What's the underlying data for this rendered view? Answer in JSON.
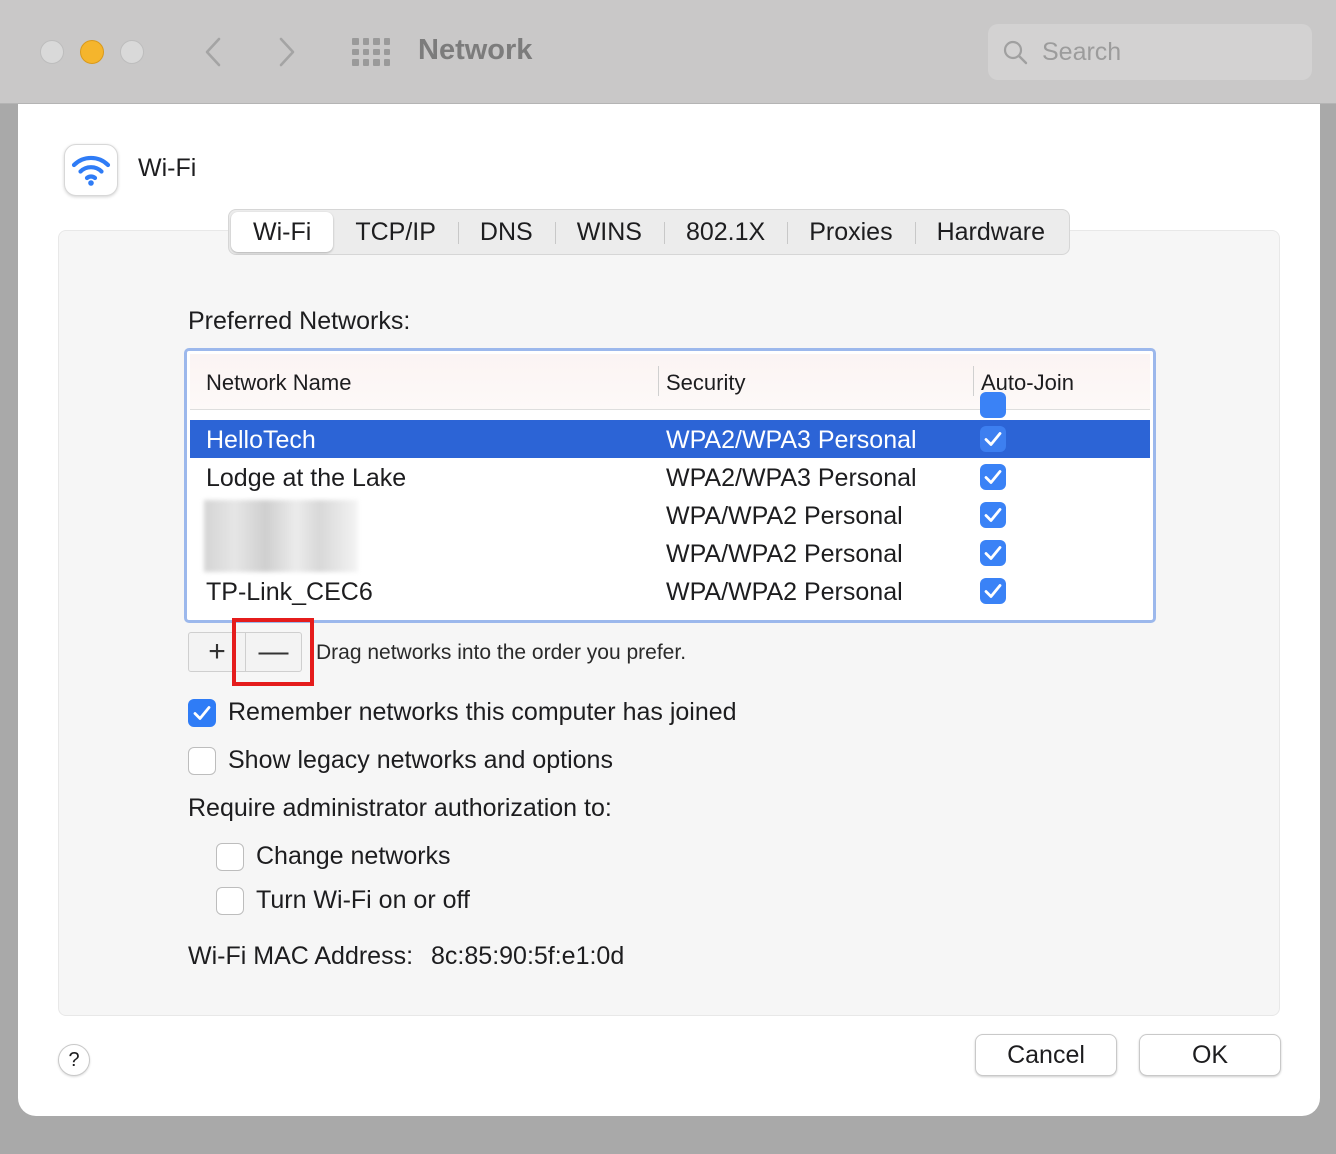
{
  "window": {
    "title": "Network",
    "search_placeholder": "Search"
  },
  "sheet": {
    "interface_name": "Wi-Fi",
    "tabs": [
      {
        "label": "Wi-Fi",
        "active": true
      },
      {
        "label": "TCP/IP"
      },
      {
        "label": "DNS"
      },
      {
        "label": "WINS"
      },
      {
        "label": "802.1X"
      },
      {
        "label": "Proxies"
      },
      {
        "label": "Hardware"
      }
    ],
    "preferred_label": "Preferred Networks:",
    "table": {
      "columns": [
        "Network Name",
        "Security",
        "Auto-Join"
      ],
      "rows": [
        {
          "name": "HelloTech",
          "security": "WPA2/WPA3 Personal",
          "auto_join": true,
          "selected": true
        },
        {
          "name": "Lodge at the Lake",
          "security": "WPA2/WPA3 Personal",
          "auto_join": true
        },
        {
          "name": "",
          "security": "WPA/WPA2 Personal",
          "auto_join": true,
          "redacted": true
        },
        {
          "name": "",
          "security": "WPA/WPA2 Personal",
          "auto_join": true,
          "redacted": true
        },
        {
          "name": "TP-Link_CEC6",
          "security": "WPA/WPA2 Personal",
          "auto_join": true
        }
      ]
    },
    "add_label": "+",
    "remove_label": "—",
    "drag_hint": "Drag networks into the order you prefer.",
    "remember_label": "Remember networks this computer has joined",
    "remember_checked": true,
    "legacy_label": "Show legacy networks and options",
    "legacy_checked": false,
    "admin_label": "Require administrator authorization to:",
    "change_networks_label": "Change networks",
    "change_networks_checked": false,
    "turn_wifi_label": "Turn Wi-Fi on or off",
    "turn_wifi_checked": false,
    "mac_label": "Wi-Fi MAC Address:",
    "mac_value": "8c:85:90:5f:e1:0d",
    "help_label": "?",
    "cancel_label": "Cancel",
    "ok_label": "OK"
  },
  "colors": {
    "accent": "#2f7cf6",
    "selection": "#2c64d6",
    "highlight": "#e51c1c"
  }
}
